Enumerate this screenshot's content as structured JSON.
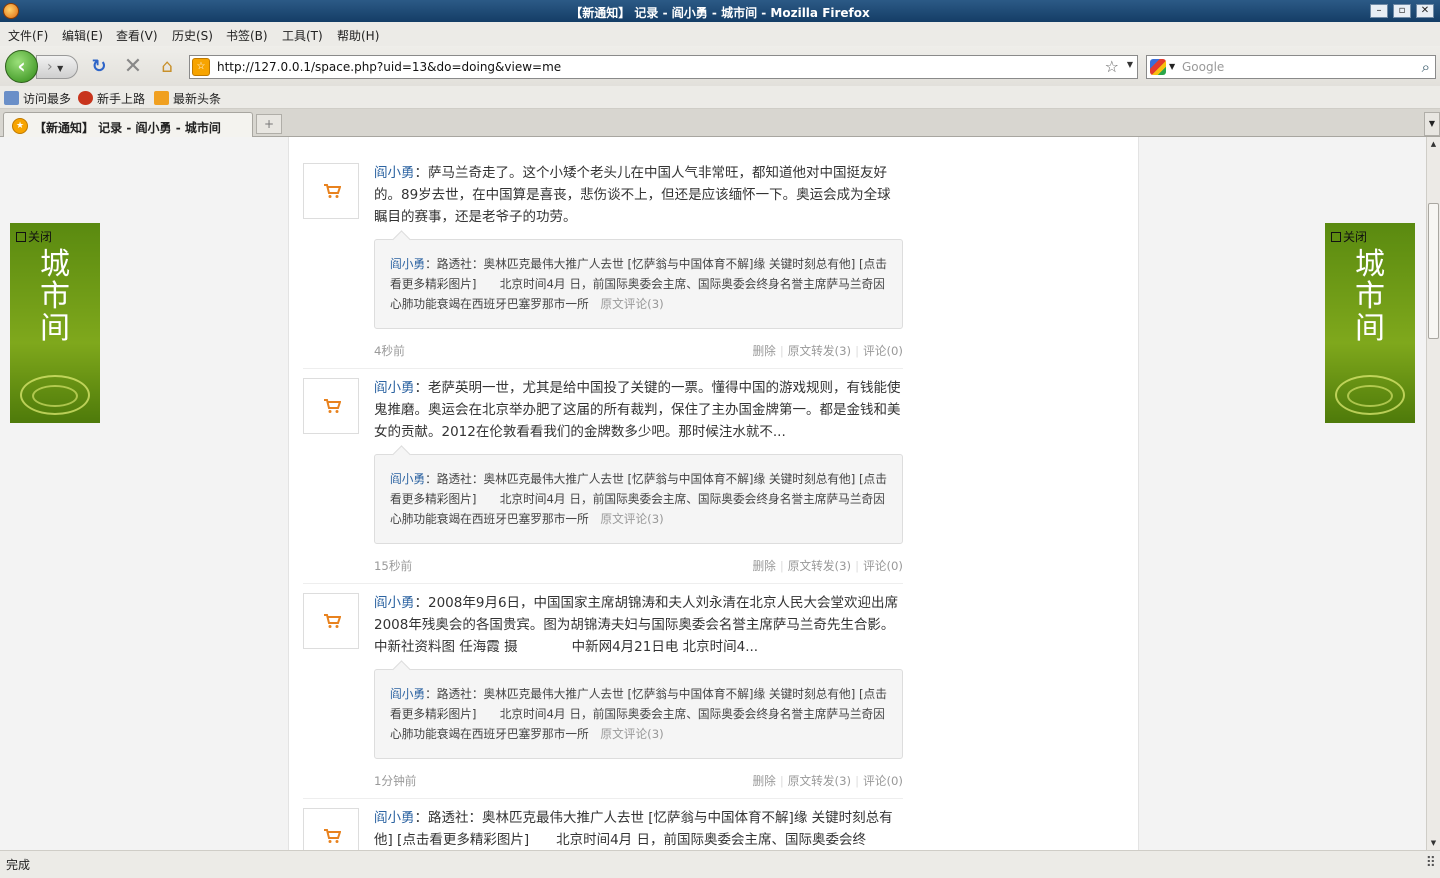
{
  "window": {
    "title": "【新通知】 记录 - 阎小勇 - 城市间 - Mozilla Firefox"
  },
  "menu": [
    "文件(F)",
    "编辑(E)",
    "查看(V)",
    "历史(S)",
    "书签(B)",
    "工具(T)",
    "帮助(H)"
  ],
  "nav": {
    "url": "http://127.0.0.1/space.php?uid=13&do=doing&view=me",
    "search_placeholder": "Google"
  },
  "bookmarks": [
    {
      "label": "访问最多",
      "icon": "most-visited-icon"
    },
    {
      "label": "新手上路",
      "icon": "getting-started-icon"
    },
    {
      "label": "最新头条",
      "icon": "rss-feed-icon"
    }
  ],
  "tab": {
    "label": "【新通知】 记录 - 阎小勇 - 城市间",
    "newtab": "+"
  },
  "quote_common": {
    "author": "阎小勇",
    "text": "：路透社：奥林匹克最伟大推广人去世 [忆萨翁与中国体育不解]缘 关键时刻总有他] [点击看更多精彩图片]　　北京时间4月 日，前国际奥委会主席、国际奥委会终身名誉主席萨马兰奇因心肺功能衰竭在西班牙巴塞罗那市一所",
    "orig": "原文评论(3)"
  },
  "entries": [
    {
      "author": "阎小勇",
      "text": "：萨马兰奇走了。这个小矮个老头儿在中国人气非常旺，都知道他对中国挺友好的。89岁去世，在中国算是喜丧，悲伤谈不上，但还是应该缅怀一下。奥运会成为全球瞩目的赛事，还是老爷子的功劳。",
      "time": "4秒前",
      "delete": "删除",
      "forward": "原文转发(3)",
      "comment": "评论(0)"
    },
    {
      "author": "阎小勇",
      "text": "：老萨英明一世，尤其是给中国投了关键的一票。懂得中国的游戏规则，有钱能使鬼推磨。奥运会在北京举办肥了这届的所有裁判，保住了主办国金牌第一。都是金钱和美女的贡献。2012在伦敦看看我们的金牌数多少吧。那时候注水就不...",
      "time": "15秒前",
      "delete": "删除",
      "forward": "原文转发(3)",
      "comment": "评论(0)"
    },
    {
      "author": "阎小勇",
      "text": "：2008年9月6日，中国国家主席胡锦涛和夫人刘永清在北京人民大会堂欢迎出席2008年残奥会的各国贵宾。图为胡锦涛夫妇与国际奥委会名誉主席萨马兰奇先生合影。 中新社资料图 任海霞 摄　　　　中新网4月21日电 北京时间4...",
      "time": "1分钟前",
      "delete": "删除",
      "forward": "原文转发(3)",
      "comment": "评论(0)"
    },
    {
      "author": "阎小勇",
      "text": "：路透社：奥林匹克最伟大推广人去世 [忆萨翁与中国体育不解]缘 关键时刻总有他] [点击看更多精彩图片]　　北京时间4月 日，前国际奥委会主席、国际奥委会终"
    }
  ],
  "ads": {
    "close_label": "关闭",
    "brand": "城市间"
  },
  "status": {
    "text": "完成"
  },
  "colors": {
    "link": "#2d64a2",
    "accent_orange": "#e8821e",
    "ad_green": "#6f9a14"
  }
}
